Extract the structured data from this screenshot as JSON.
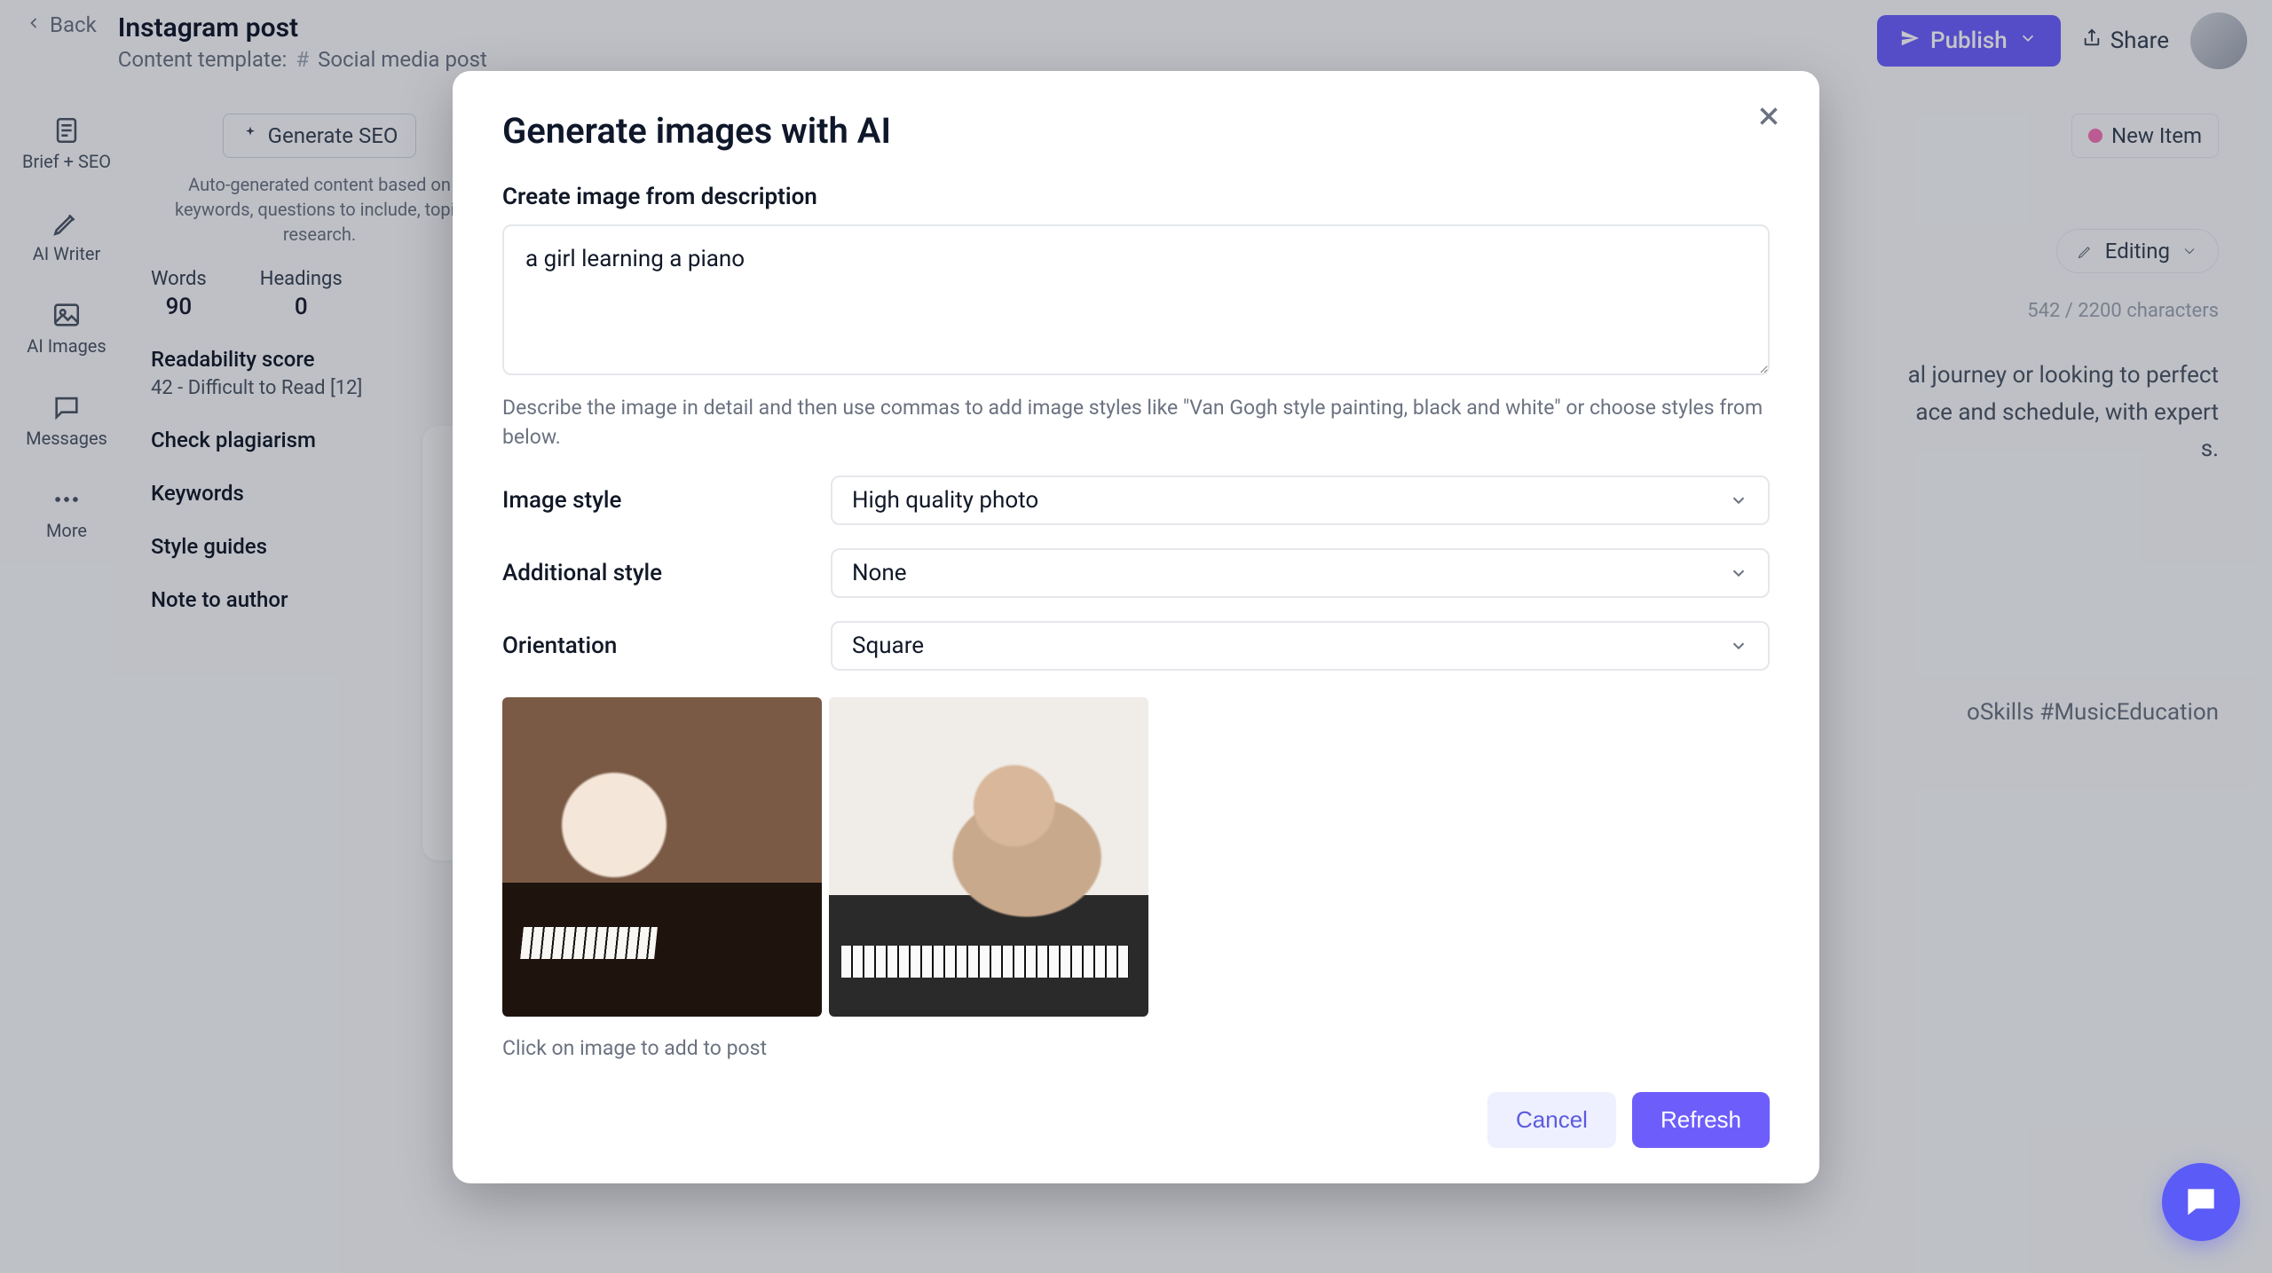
{
  "header": {
    "back": "Back",
    "page_title": "Instagram post",
    "template_label": "Content template:",
    "template_value": "Social media post",
    "publish": "Publish",
    "share": "Share"
  },
  "rail": {
    "brief_seo": "Brief + SEO",
    "ai_writer": "AI Writer",
    "ai_images": "AI Images",
    "messages": "Messages",
    "more": "More"
  },
  "seo": {
    "generate_btn": "Generate SEO",
    "desc": "Auto-generated content based on keywords, questions to include, topic research.",
    "words_label": "Words",
    "words_value": "90",
    "headings_label": "Headings",
    "headings_value": "0",
    "readability_label": "Readability score",
    "readability_value": "42 - Difficult to Read [12]",
    "plagiarism_label": "Check plagiarism",
    "keywords_label": "Keywords",
    "styleguides_label": "Style guides",
    "note_label": "Note to author"
  },
  "right": {
    "new_item": "New Item",
    "editing": "Editing",
    "char_count": "542 / 2200 characters",
    "body_snippet_1": "al journey or looking to perfect",
    "body_snippet_2": "ace and schedule, with expert",
    "body_snippet_3": "s.",
    "hashtags": "oSkills #MusicEducation"
  },
  "modal": {
    "title": "Generate images with AI",
    "desc_label": "Create image from description",
    "desc_value": "a girl learning a piano",
    "desc_help": "Describe the image in detail and then use commas to add image styles like \"Van Gogh style painting, black and white\" or choose styles from below.",
    "image_style_label": "Image style",
    "image_style_value": "High quality photo",
    "additional_style_label": "Additional style",
    "additional_style_value": "None",
    "orientation_label": "Orientation",
    "orientation_value": "Square",
    "thumb_help": "Click on image to add to post",
    "cancel": "Cancel",
    "refresh": "Refresh"
  }
}
